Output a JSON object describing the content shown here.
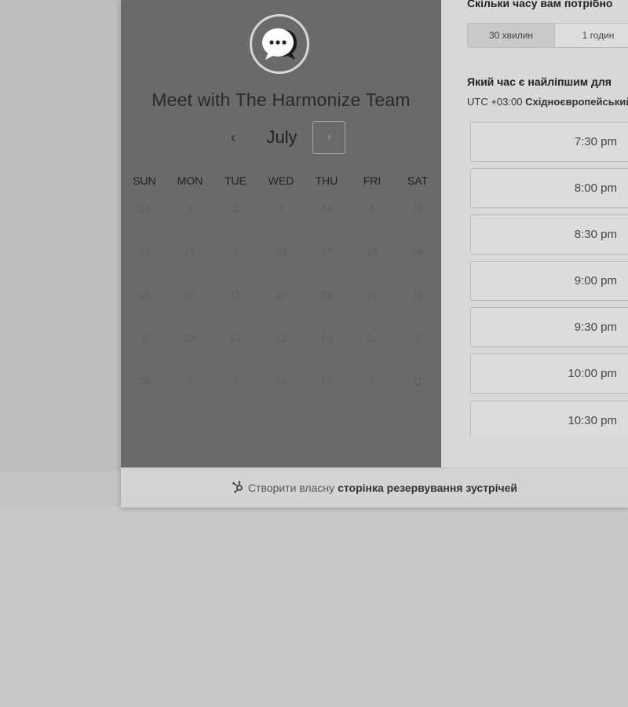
{
  "calendar": {
    "title": "Meet with The Harmonize Team",
    "month": "July",
    "prev_glyph": "‹",
    "next_glyph": "›",
    "weekdays": [
      "SUN",
      "MON",
      "TUE",
      "WED",
      "THU",
      "FRI",
      "SAT"
    ],
    "weeks": [
      [
        "24",
        "3",
        "3",
        "8",
        "14",
        "5",
        "19"
      ],
      [
        "24",
        "19",
        "2",
        "30",
        "17",
        "16",
        "24"
      ],
      [
        "15",
        "20",
        "17",
        "21",
        "24",
        "29",
        "16"
      ],
      [
        "4",
        "28",
        "27",
        "31",
        "10",
        "26",
        "7"
      ],
      [
        "29",
        "5",
        "1",
        "10",
        "10",
        "3",
        "11"
      ]
    ]
  },
  "scheduler": {
    "duration_question": "Скільки часу вам потрібно",
    "durations": [
      "30 хвилин",
      "1 годин"
    ],
    "selected_duration": "30 хвилин",
    "time_question": "Який час є найліпшим для",
    "timezone_prefix": "UTC +03:00",
    "timezone_name": "Східноєвропейський",
    "slots": [
      "7:30 pm",
      "8:00 pm",
      "8:30 pm",
      "9:00 pm",
      "9:30 pm",
      "10:00 pm",
      "10:30 pm"
    ]
  },
  "footer": {
    "prefix": "Створити власну",
    "link": "сторінка резервування зустрічей",
    "icon": "hubspot-sprocket-icon"
  },
  "colors": {
    "left_panel": "#6a6a6a",
    "right_panel": "#d8d8d8"
  }
}
